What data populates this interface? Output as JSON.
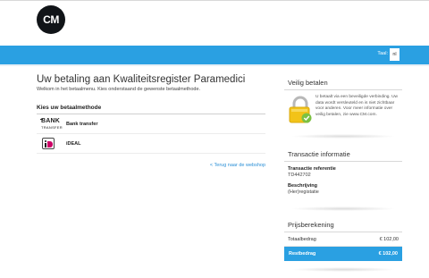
{
  "header": {
    "logo_text": "CM",
    "lang_label": "Taal:",
    "lang_value": "nl"
  },
  "main": {
    "title": "Uw betaling aan Kwaliteitsregister Paramedici",
    "subtitle": "Welkom in het betaalmenu. Kies onderstaand de gewenste betaalmethode.",
    "section_header": "Kies uw betaalmethode",
    "methods": [
      {
        "label": "Bank transfer",
        "logo_line1": "BANK",
        "logo_line2": "TRANSFER",
        "icon": "bank-transfer-icon"
      },
      {
        "label": "iDEAL",
        "icon": "ideal-icon"
      }
    ],
    "back_link": "< Terug naar de webshop"
  },
  "sidebar": {
    "secure": {
      "title": "Veilig betalen",
      "text": "U betaalt via een beveiligde verbinding. Uw data wordt versleuteld en is niet zichtbaar voor anderen. Voor meer informatie over veilig betalen, zie www.CM.com."
    },
    "transaction": {
      "title": "Transactie informatie",
      "reference_label": "Transactie referentie",
      "reference_value": "TD442702",
      "description_label": "Beschrijving",
      "description_value": "(Her)registatie"
    },
    "pricing": {
      "title": "Prijsberekening",
      "total_label": "Totaalbedrag",
      "total_value": "€ 102,00",
      "rest_label": "Restbedrag",
      "rest_value": "€ 102,00"
    }
  },
  "colors": {
    "accent": "#2aa0e2",
    "link": "#2a8fd6",
    "logo_bg": "#111418",
    "ideal": "#cc0066"
  }
}
